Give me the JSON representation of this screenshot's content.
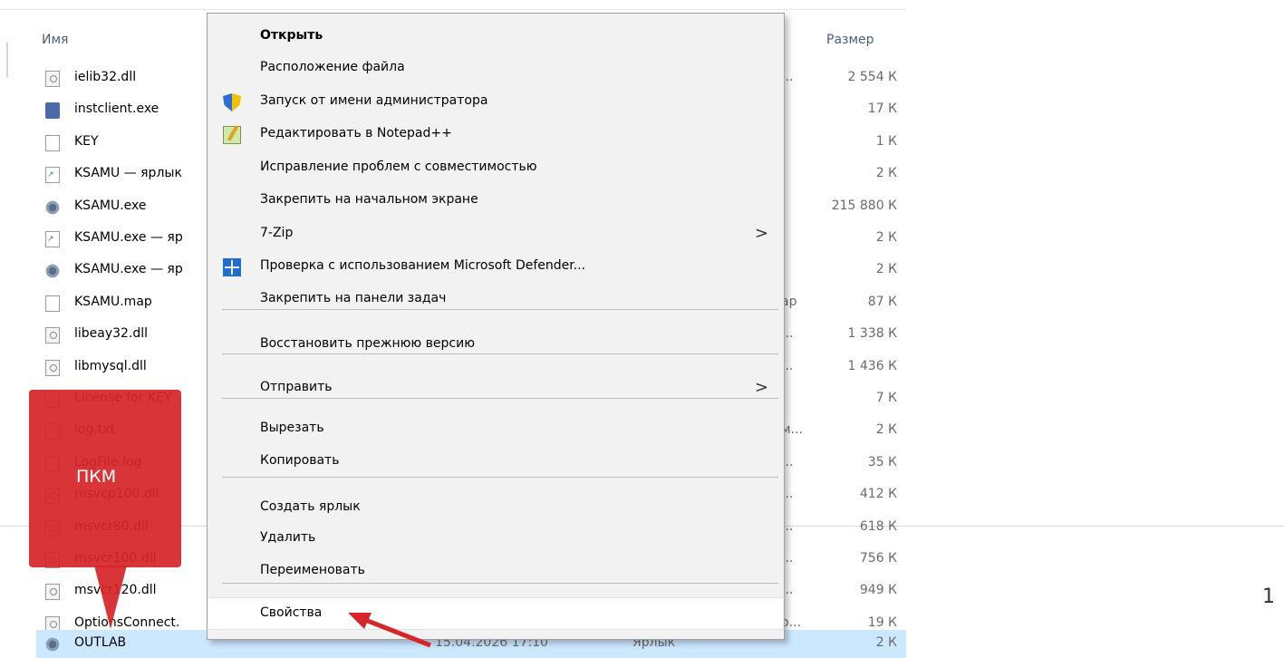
{
  "explorer": {
    "col_name": "Имя",
    "col_size": "Размер",
    "rows": [
      {
        "name": "ielib32.dll",
        "mid": "...",
        "size": "2 554 К",
        "icon": "dll-icon"
      },
      {
        "name": "instclient.exe",
        "mid": "",
        "size": "17 К",
        "icon": "exe-icon"
      },
      {
        "name": "KEY",
        "mid": "",
        "size": "1 К",
        "icon": "file-icon"
      },
      {
        "name": "KSAMU — ярлык",
        "mid": "",
        "size": "2 К",
        "icon": "shortcut-icon"
      },
      {
        "name": "KSAMU.exe",
        "mid": "",
        "size": "215 880 К",
        "icon": "gear-app-icon"
      },
      {
        "name": "KSAMU.exe — яр",
        "mid": "",
        "size": "2 К",
        "icon": "shortcut-icon"
      },
      {
        "name": "KSAMU.exe — яр",
        "mid": "",
        "size": "2 К",
        "icon": "gear-app-icon"
      },
      {
        "name": "KSAMU.map",
        "mid": "ар",
        "size": "87 К",
        "icon": "file-icon"
      },
      {
        "name": "libeay32.dll",
        "mid": "...",
        "size": "1 338 К",
        "icon": "dll-icon"
      },
      {
        "name": "libmysql.dll",
        "mid": "...",
        "size": "1 436 К",
        "icon": "dll-icon"
      },
      {
        "name": "License for KEY",
        "mid": "",
        "size": "7 К",
        "icon": "file-icon"
      },
      {
        "name": "log.txt",
        "mid": "м...",
        "size": "2 К",
        "icon": "file-icon"
      },
      {
        "name": "LogFile.log",
        "mid": "...",
        "size": "35 К",
        "icon": "file-icon"
      },
      {
        "name": "msvcp100.dll",
        "mid": "...",
        "size": "412 К",
        "icon": "dll-icon"
      },
      {
        "name": "msvcr80.dll",
        "mid": "...",
        "size": "618 К",
        "icon": "dll-icon"
      },
      {
        "name": "msvcr100.dll",
        "mid": "...",
        "size": "756 К",
        "icon": "dll-icon"
      },
      {
        "name": "msvcr120.dll",
        "mid": "...",
        "size": "949 К",
        "icon": "dll-icon"
      },
      {
        "name": "OptionsConnect.",
        "mid": "о...",
        "size": "19 К",
        "icon": "settings-file-icon"
      }
    ],
    "selected_row": {
      "name": "OUTLAB",
      "date": "15.04.2026 17:10",
      "type": "Ярлык",
      "size": "2 К"
    }
  },
  "callout": {
    "text": "ПКМ",
    "color": "#d6262a"
  },
  "context_menu": {
    "items": [
      {
        "label": "Открыть",
        "bold": true
      },
      {
        "label": "Расположение файла"
      },
      {
        "label": "Запуск от имени администратора",
        "icon": "uac-shield-icon"
      },
      {
        "label": "Редактировать в Notepad++",
        "icon": "notepad-plus-plus-icon"
      },
      {
        "label": "Исправление проблем с совместимостью"
      },
      {
        "label": "Закрепить на начальном экране"
      },
      {
        "label": "7-Zip",
        "submenu": true
      },
      {
        "label": "Проверка с использованием Microsoft Defender...",
        "icon": "defender-icon"
      },
      {
        "label": "Закрепить на панели задач"
      },
      {
        "label": "Восстановить прежнюю версию"
      },
      {
        "label": "Отправить",
        "submenu": true
      },
      {
        "label": "Вырезать"
      },
      {
        "label": "Копировать"
      },
      {
        "label": "Создать ярлык"
      },
      {
        "label": "Удалить"
      },
      {
        "label": "Переименовать"
      },
      {
        "label": "Свойства",
        "highlighted": true
      }
    ],
    "submenu_arrow": ">"
  },
  "page_number": "1"
}
